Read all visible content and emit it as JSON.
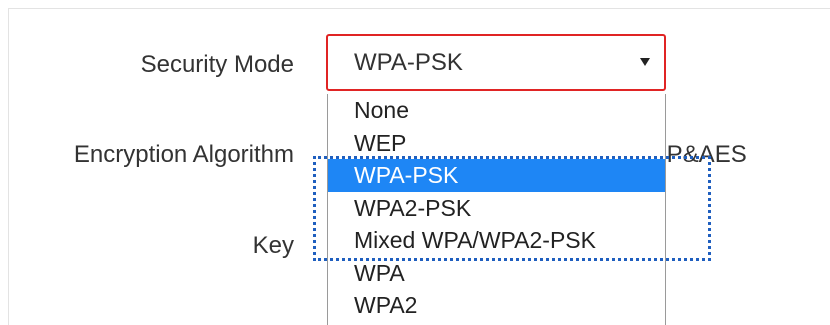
{
  "form": {
    "security_mode_label": "Security Mode",
    "encryption_algorithm_label": "Encryption Algorithm",
    "encryption_algorithm_value_partial": "IP&AES",
    "key_label": "Key"
  },
  "security_mode_select": {
    "selected_value": "WPA-PSK",
    "options": [
      "None",
      "WEP",
      "WPA-PSK",
      "WPA2-PSK",
      "Mixed WPA/WPA2-PSK",
      "WPA",
      "WPA2"
    ],
    "highlighted_option": "WPA-PSK"
  },
  "colors": {
    "select_border": "#e02424",
    "option_highlight": "#1e86f5",
    "dotted_highlight": "#1f5fbf"
  }
}
